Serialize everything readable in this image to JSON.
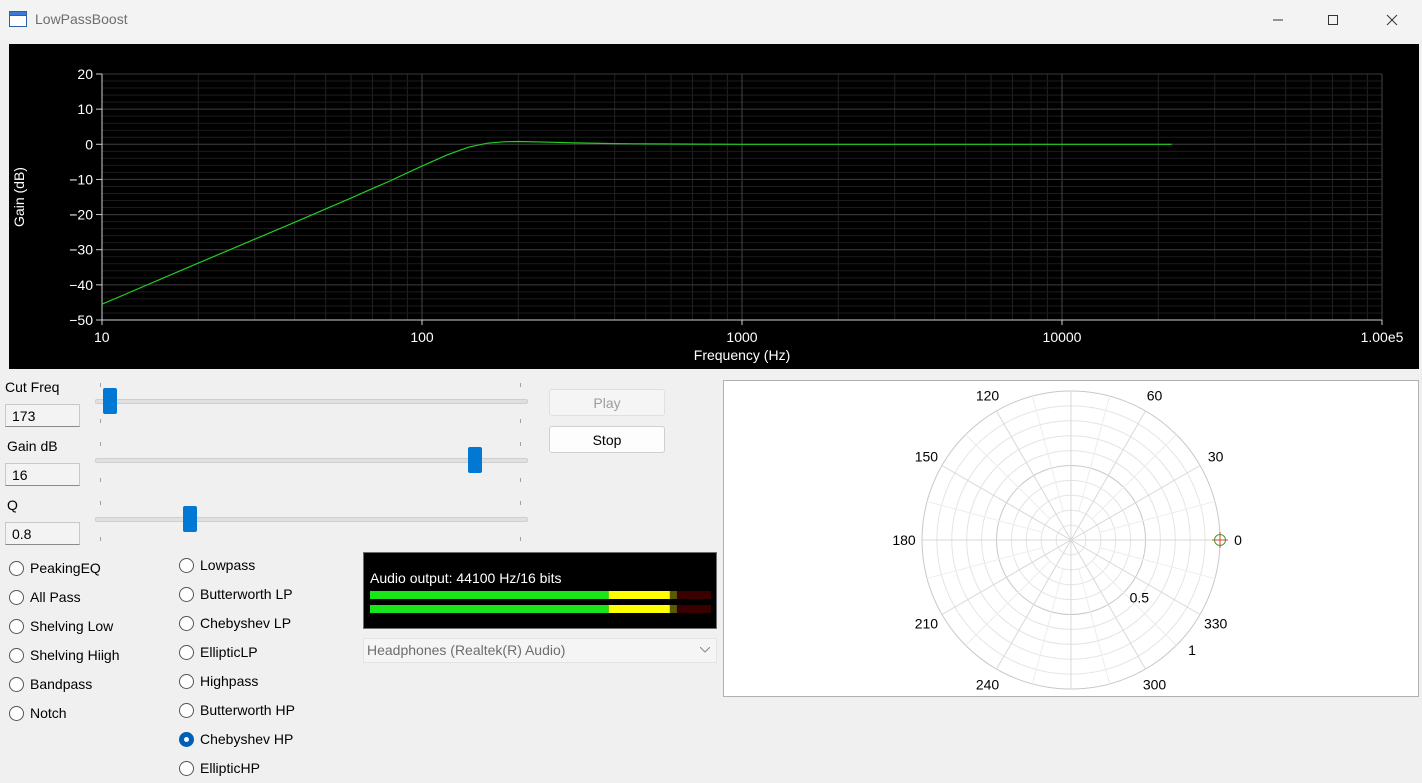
{
  "window": {
    "title": "LowPassBoost"
  },
  "chart_data": {
    "type": "line",
    "xlabel": "Frequency (Hz)",
    "ylabel": "Gain (dB)",
    "x_scale": "log",
    "xlim": [
      10,
      100000
    ],
    "ylim": [
      -50,
      20
    ],
    "x_ticks": [
      "10",
      "100",
      "1000",
      "10000",
      "1.00e5"
    ],
    "y_ticks": [
      "20",
      "10",
      "0",
      "−10",
      "−20",
      "−30",
      "−40",
      "−50"
    ],
    "grid": true,
    "series": [
      {
        "color": "#22cc22",
        "x": [
          10,
          20,
          30,
          40,
          50,
          60,
          70,
          80,
          90,
          100,
          120,
          140,
          160,
          180,
          200,
          250,
          300,
          400,
          500,
          700,
          1000,
          2000,
          5000,
          10000,
          22000
        ],
        "y": [
          -45.5,
          -33.8,
          -27.0,
          -22.2,
          -18.4,
          -15.3,
          -12.6,
          -10.3,
          -8.1,
          -6.2,
          -3.0,
          -0.8,
          0.3,
          0.7,
          0.8,
          0.6,
          0.4,
          0.2,
          0.1,
          0.05,
          0.0,
          0.0,
          0.0,
          0.0,
          0.0
        ]
      }
    ]
  },
  "controls": {
    "cut_freq": {
      "label": "Cut Freq",
      "value": "173",
      "fraction": 0.02
    },
    "gain_db": {
      "label": "Gain dB",
      "value": "16",
      "fraction": 0.89
    },
    "q": {
      "label": "Q",
      "value": "0.8",
      "fraction": 0.21
    }
  },
  "filter_types_left": [
    {
      "label": "PeakingEQ",
      "selected": false
    },
    {
      "label": "All Pass",
      "selected": false
    },
    {
      "label": "Shelving Low",
      "selected": false
    },
    {
      "label": "Shelving Hiigh",
      "selected": false
    },
    {
      "label": "Bandpass",
      "selected": false
    },
    {
      "label": "Notch",
      "selected": false
    }
  ],
  "filter_types_right": [
    {
      "label": "Lowpass",
      "selected": false
    },
    {
      "label": "Butterworth LP",
      "selected": false
    },
    {
      "label": "Chebyshev LP",
      "selected": false
    },
    {
      "label": "EllipticLP",
      "selected": false
    },
    {
      "label": "Highpass",
      "selected": false
    },
    {
      "label": "Butterworth HP",
      "selected": false
    },
    {
      "label": "Chebyshev HP",
      "selected": true
    },
    {
      "label": "EllipticHP",
      "selected": false
    }
  ],
  "buttons": {
    "play": "Play",
    "stop": "Stop"
  },
  "audio": {
    "status": "Audio output: 44100 Hz/16 bits",
    "level_left": 0.9,
    "level_right": 0.9,
    "device": "Headphones (Realtek(R) Audio)"
  },
  "polar": {
    "angle_labels": [
      "0",
      "30",
      "60",
      "120",
      "150",
      "180",
      "210",
      "240",
      "300",
      "330"
    ],
    "radial_labels": [
      "0.5",
      "1"
    ],
    "point": {
      "angle": 0,
      "radius": 1
    }
  }
}
